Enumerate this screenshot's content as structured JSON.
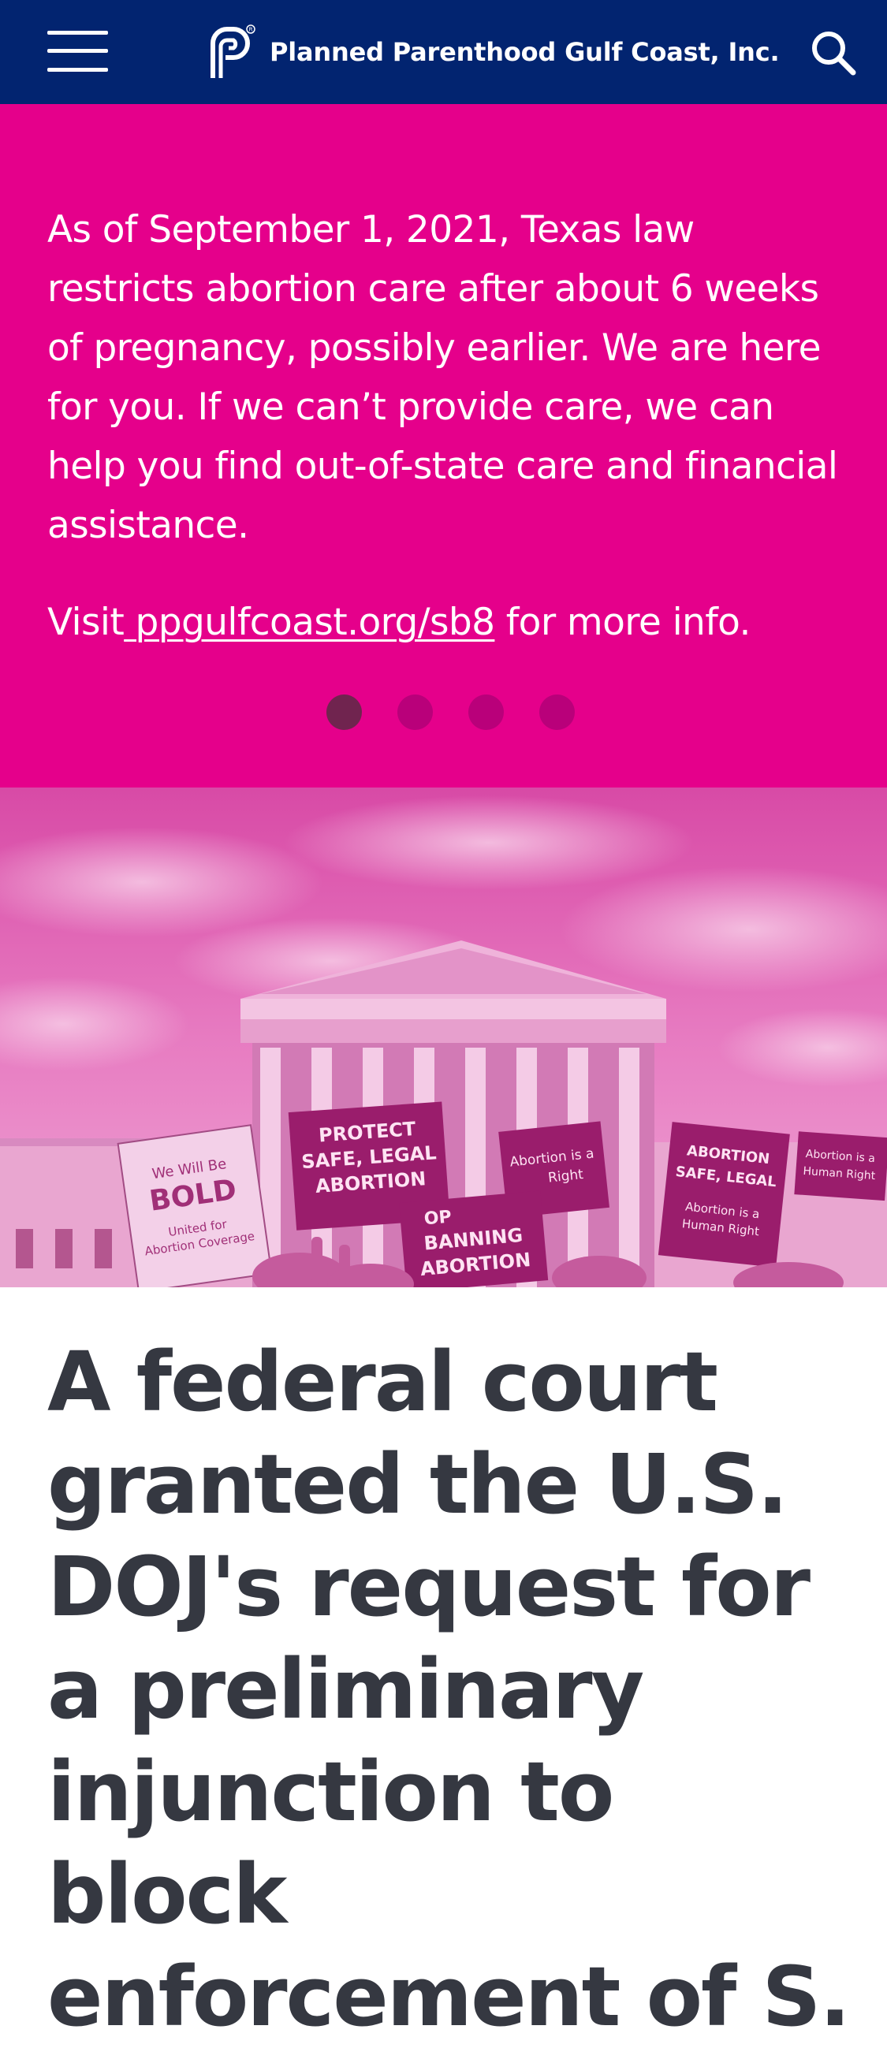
{
  "header": {
    "org_name": "Planned Parenthood Gulf Coast, Inc.",
    "background_color": "#022470",
    "menu_icon": "hamburger-menu-icon",
    "search_icon": "search-icon",
    "logo_icon": "planned-parenthood-logo-icon"
  },
  "alert": {
    "background_color": "#e5008b",
    "message": "As of September 1, 2021, Texas law restricts abortion care after about 6 weeks of pregnancy, possibly earlier. We are here for you. If we can’t provide care, we can help you find out-of-state care and financial assistance.",
    "visit_prefix": "Visit",
    "link_text": " ppgulfcoast.org/sb8",
    "visit_suffix": " for more info.",
    "carousel_total": 4,
    "carousel_active": 1
  },
  "hero": {
    "signs": {
      "sign1_line1": "PROTECT",
      "sign1_line2": "SAFE, LEGAL",
      "sign1_line3": "ABORTION",
      "sign2_line1": "We Will Be",
      "sign2_line2": "BOLD",
      "sign2_line3": "United for",
      "sign2_line4": "Abortion Coverage",
      "sign3_line1": "Abortion is a",
      "sign3_line2": "Right",
      "sign4_line1": "OP",
      "sign4_line2": "BANNING",
      "sign4_line3": "ABORTION",
      "sign5_line1": "ABORTION",
      "sign5_line2": "SAFE, LEGAL",
      "sign5_line3": "Abortion is a",
      "sign5_line4": "Human Right",
      "sign6_line1": "Abortion is a",
      "sign6_line2": "Human Right"
    }
  },
  "article": {
    "headline": "A federal court granted the U.S. DOJ's request for a preliminary injunction to block enforcement of S."
  }
}
